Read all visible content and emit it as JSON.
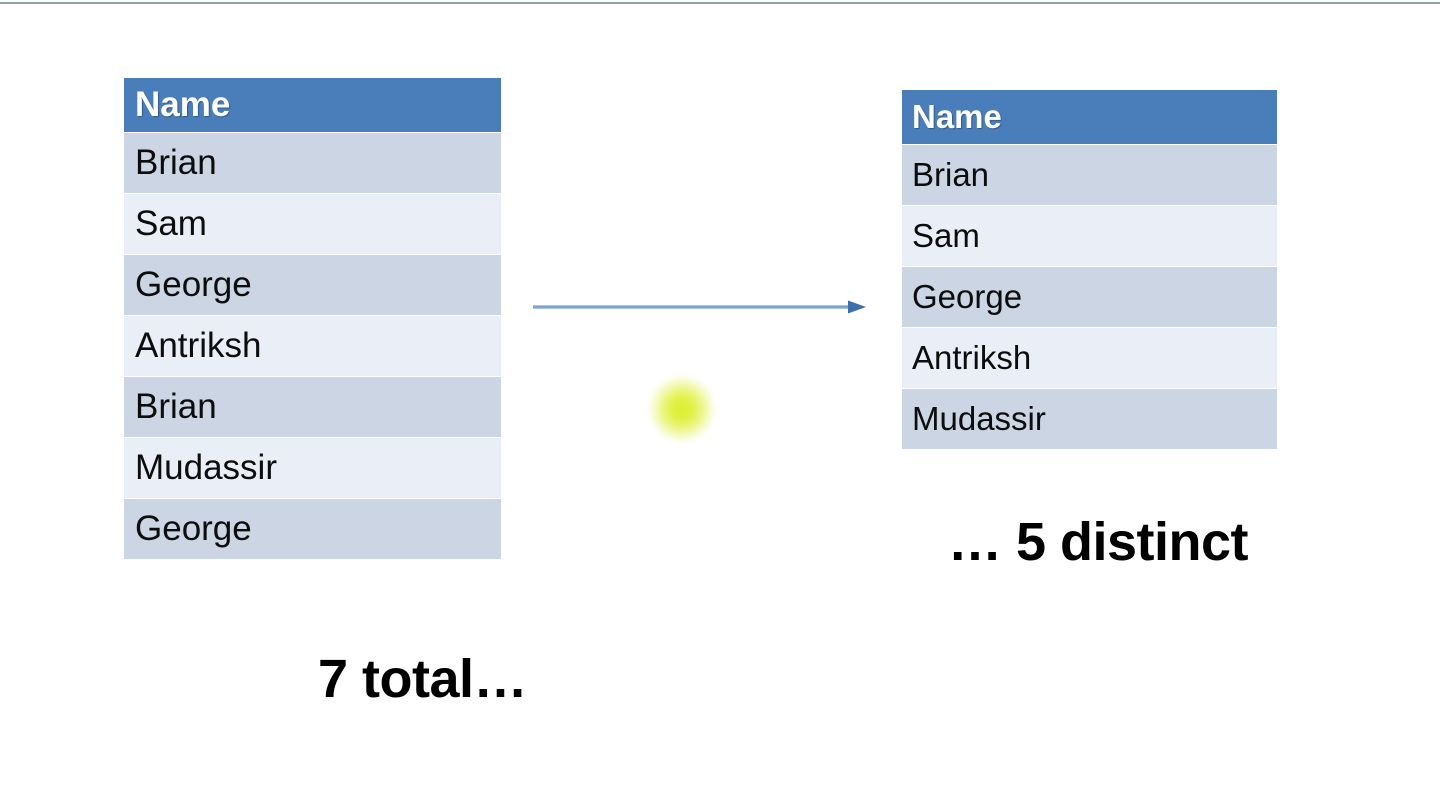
{
  "slide": {
    "background_color": "#ffffff",
    "top_rule_color": "#8fa3ad"
  },
  "theme": {
    "header_fill": "#4a7ebb",
    "header_text_color": "#ffffff",
    "row_fill_odd": "#ccd5e4",
    "row_fill_even": "#eaeef6",
    "row_text_color": "#0d0d0d",
    "arrow_line_color": "#7ba3cc",
    "arrow_head_color": "#3d6fad",
    "cursor_highlight_color": "#daee20"
  },
  "table_left": {
    "header": "Name",
    "rows": [
      "Brian",
      "Sam",
      "George",
      "Antriksh",
      "Brian",
      "Mudassir",
      "George"
    ],
    "row_count": 7
  },
  "table_right": {
    "header": "Name",
    "rows": [
      "Brian",
      "Sam",
      "George",
      "Antriksh",
      "Mudassir"
    ],
    "row_count": 5
  },
  "captions": {
    "total": "7 total…",
    "distinct": "… 5 distinct"
  },
  "arrow": {
    "label": "transforms-to-arrow",
    "direction": "right"
  }
}
